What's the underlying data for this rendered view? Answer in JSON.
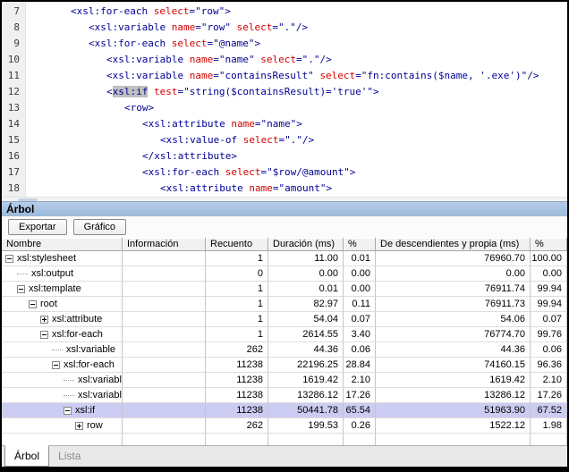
{
  "editor": {
    "lines": [
      {
        "num": "7",
        "indent": 0,
        "tokens": [
          {
            "t": "<xsl:for-each ",
            "c": "n"
          },
          {
            "t": "select",
            "c": "r"
          },
          {
            "t": "=\"row\">",
            "c": "n"
          }
        ]
      },
      {
        "num": "8",
        "indent": 1,
        "tokens": [
          {
            "t": "<xsl:variable ",
            "c": "n"
          },
          {
            "t": "name",
            "c": "r"
          },
          {
            "t": "=\"row\" ",
            "c": "n"
          },
          {
            "t": "select",
            "c": "r"
          },
          {
            "t": "=\".\"/>",
            "c": "n"
          }
        ]
      },
      {
        "num": "9",
        "indent": 1,
        "tokens": [
          {
            "t": "<xsl:for-each ",
            "c": "n"
          },
          {
            "t": "select",
            "c": "r"
          },
          {
            "t": "=\"@name\">",
            "c": "n"
          }
        ]
      },
      {
        "num": "10",
        "indent": 2,
        "tokens": [
          {
            "t": "<xsl:variable ",
            "c": "n"
          },
          {
            "t": "name",
            "c": "r"
          },
          {
            "t": "=\"name\" ",
            "c": "n"
          },
          {
            "t": "select",
            "c": "r"
          },
          {
            "t": "=\".\"/>",
            "c": "n"
          }
        ]
      },
      {
        "num": "11",
        "indent": 2,
        "tokens": [
          {
            "t": "<xsl:variable ",
            "c": "n"
          },
          {
            "t": "name",
            "c": "r"
          },
          {
            "t": "=\"containsResult\" ",
            "c": "n"
          },
          {
            "t": "select",
            "c": "r"
          },
          {
            "t": "=\"fn:contains($name, '.exe')\"/>",
            "c": "n"
          }
        ]
      },
      {
        "num": "12",
        "indent": 2,
        "tokens": [
          {
            "t": "<",
            "c": "n"
          },
          {
            "t": "xsl:if",
            "c": "h"
          },
          {
            "t": " ",
            "c": "n"
          },
          {
            "t": "test",
            "c": "r"
          },
          {
            "t": "=\"string($containsResult)='true'\">",
            "c": "n"
          }
        ]
      },
      {
        "num": "13",
        "indent": 3,
        "tokens": [
          {
            "t": "<row>",
            "c": "n"
          }
        ]
      },
      {
        "num": "14",
        "indent": 4,
        "tokens": [
          {
            "t": "<xsl:attribute ",
            "c": "n"
          },
          {
            "t": "name",
            "c": "r"
          },
          {
            "t": "=\"name\">",
            "c": "n"
          }
        ]
      },
      {
        "num": "15",
        "indent": 5,
        "tokens": [
          {
            "t": "<xsl:value-of ",
            "c": "n"
          },
          {
            "t": "select",
            "c": "r"
          },
          {
            "t": "=\".\"/>",
            "c": "n"
          }
        ]
      },
      {
        "num": "16",
        "indent": 4,
        "tokens": [
          {
            "t": "</xsl:attribute>",
            "c": "n"
          }
        ]
      },
      {
        "num": "17",
        "indent": 4,
        "tokens": [
          {
            "t": "<xsl:for-each ",
            "c": "n"
          },
          {
            "t": "select",
            "c": "r"
          },
          {
            "t": "=\"$row/@amount\">",
            "c": "n"
          }
        ]
      },
      {
        "num": "18",
        "indent": 5,
        "tokens": [
          {
            "t": "<xsl:attribute ",
            "c": "n"
          },
          {
            "t": "name",
            "c": "r"
          },
          {
            "t": "=\"amount\">",
            "c": "n"
          }
        ]
      }
    ]
  },
  "panel": {
    "title": "Árbol",
    "toolbar": {
      "export_label": "Exportar",
      "chart_label": "Gráfico"
    },
    "table": {
      "columns": [
        "Nombre",
        "Información",
        "Recuento",
        "Duración (ms)",
        "%",
        "De descendientes y propia (ms)",
        "%"
      ],
      "rows": [
        {
          "name": "xsl:stylesheet",
          "level": 0,
          "expander": "minus",
          "info": "",
          "count": "1",
          "duration": "11.00",
          "pct": "0.01",
          "desc": "76960.70",
          "descPct": "100.00",
          "selected": false
        },
        {
          "name": "xsl:output",
          "level": 1,
          "expander": "leaf",
          "info": "",
          "count": "0",
          "duration": "0.00",
          "pct": "0.00",
          "desc": "0.00",
          "descPct": "0.00",
          "selected": false
        },
        {
          "name": "xsl:template",
          "level": 1,
          "expander": "minus",
          "info": "",
          "count": "1",
          "duration": "0.01",
          "pct": "0.00",
          "desc": "76911.74",
          "descPct": "99.94",
          "selected": false
        },
        {
          "name": "root",
          "level": 2,
          "expander": "minus",
          "info": "",
          "count": "1",
          "duration": "82.97",
          "pct": "0.11",
          "desc": "76911.73",
          "descPct": "99.94",
          "selected": false
        },
        {
          "name": "xsl:attribute",
          "level": 3,
          "expander": "plus",
          "info": "",
          "count": "1",
          "duration": "54.04",
          "pct": "0.07",
          "desc": "54.06",
          "descPct": "0.07",
          "selected": false
        },
        {
          "name": "xsl:for-each",
          "level": 3,
          "expander": "minus",
          "info": "",
          "count": "1",
          "duration": "2614.55",
          "pct": "3.40",
          "desc": "76774.70",
          "descPct": "99.76",
          "selected": false
        },
        {
          "name": "xsl:variable",
          "level": 4,
          "expander": "leaf",
          "info": "",
          "count": "262",
          "duration": "44.36",
          "pct": "0.06",
          "desc": "44.36",
          "descPct": "0.06",
          "selected": false
        },
        {
          "name": "xsl:for-each",
          "level": 4,
          "expander": "minus",
          "info": "",
          "count": "11238",
          "duration": "22196.25",
          "pct": "28.84",
          "desc": "74160.15",
          "descPct": "96.36",
          "selected": false
        },
        {
          "name": "xsl:variable",
          "level": 5,
          "expander": "leaf",
          "info": "",
          "count": "11238",
          "duration": "1619.42",
          "pct": "2.10",
          "desc": "1619.42",
          "descPct": "2.10",
          "selected": false
        },
        {
          "name": "xsl:variable",
          "level": 5,
          "expander": "leaf",
          "info": "",
          "count": "11238",
          "duration": "13286.12",
          "pct": "17.26",
          "desc": "13286.12",
          "descPct": "17.26",
          "selected": false
        },
        {
          "name": "xsl:if",
          "level": 5,
          "expander": "minus",
          "info": "",
          "count": "11238",
          "duration": "50441.78",
          "pct": "65.54",
          "desc": "51963.90",
          "descPct": "67.52",
          "selected": true
        },
        {
          "name": "row",
          "level": 6,
          "expander": "plus",
          "info": "",
          "count": "262",
          "duration": "199.53",
          "pct": "0.26",
          "desc": "1522.12",
          "descPct": "1.98",
          "selected": false
        }
      ]
    },
    "tabs": [
      {
        "label": "Árbol",
        "active": true
      },
      {
        "label": "Lista",
        "active": false
      }
    ]
  },
  "colors": {
    "element_name": "#000096",
    "attribute_name": "#d40000",
    "code_highlight": "#c0c0c0",
    "selected_row": "#ccccf2",
    "panel_header_blue": "#a9c4e1"
  }
}
